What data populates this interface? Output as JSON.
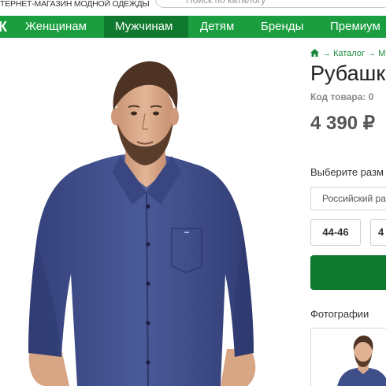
{
  "header": {
    "tagline": "ТЕРНЕТ-МАГАЗИН МОДНОЙ ОДЕЖДЫ",
    "search_placeholder": "Поиск по каталогу"
  },
  "nav": {
    "edge_glyph": "К",
    "items": [
      {
        "label": "Женщинам"
      },
      {
        "label": "Мужчинам"
      },
      {
        "label": "Детям"
      },
      {
        "label": "Бренды"
      },
      {
        "label": "Премиум"
      }
    ],
    "active_index": 1
  },
  "product": {
    "breadcrumb": {
      "catalog": "Каталог",
      "separator": "→",
      "next": "М"
    },
    "title": "Рубашк",
    "code": "Код товара: 0",
    "price": "4 390 ₽",
    "size_label": "Выберите разм",
    "size_select": "Российский ра",
    "sizes": [
      "44-46",
      "4"
    ],
    "photos_label": "Фотографии"
  },
  "colors": {
    "brand_green": "#1a9e3f",
    "active_green": "#0f7a2e",
    "link_green": "#1a8a3a",
    "shirt_blue": "#3f4f8a"
  },
  "icons": {
    "breadcrumb_home": "home-icon"
  }
}
